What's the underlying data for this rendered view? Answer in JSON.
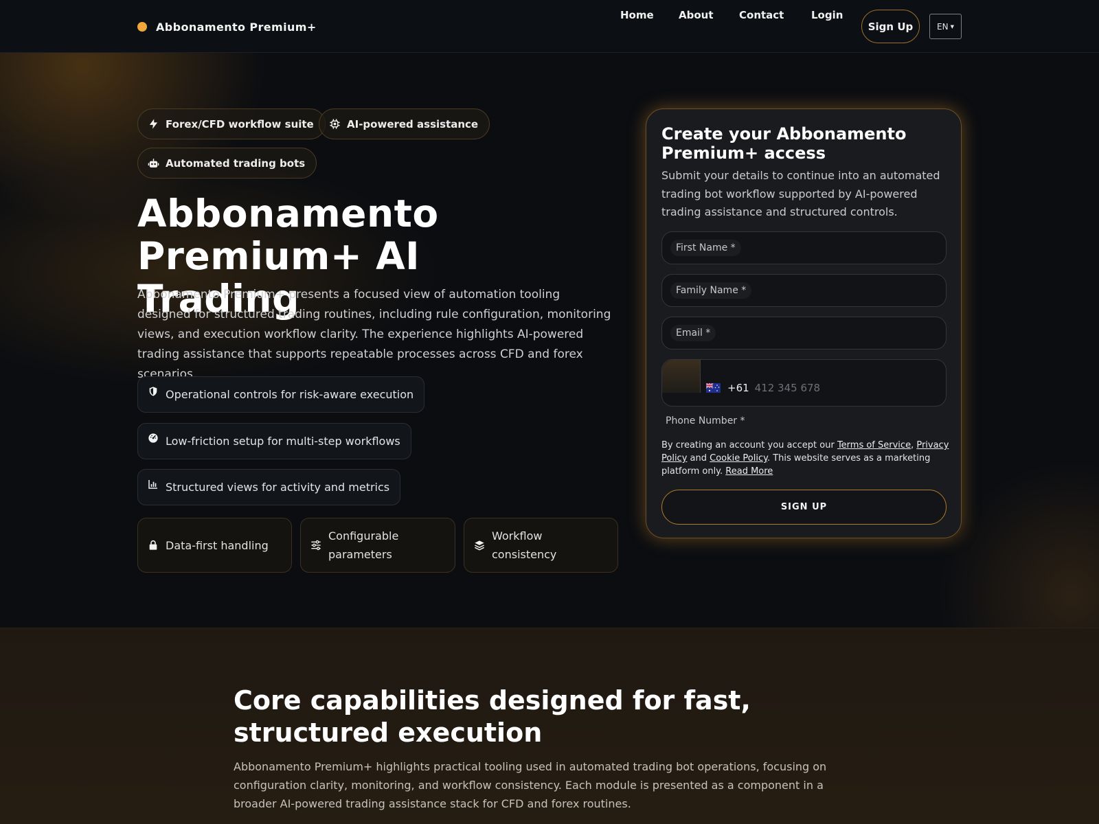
{
  "header": {
    "brand": "Abbonamento Premium+",
    "nav": [
      "Home",
      "About",
      "Contact",
      "Login"
    ],
    "signup_label": "Sign Up",
    "language": "EN"
  },
  "hero": {
    "chips": [
      "Forex/CFD workflow suite",
      "AI-powered assistance",
      "Automated trading bots"
    ],
    "title": "Abbonamento Premium+ AI Trading",
    "description": "Abbonamento Premium+ presents a focused view of automation tooling designed for structured trading routines, including rule configuration, monitoring views, and execution workflow clarity. The experience highlights AI-powered trading assistance that supports repeatable processes across CFD and forex scenarios.",
    "features": [
      "Operational controls for risk-aware execution",
      "Low-friction setup for multi-step workflows",
      "Structured views for activity and metrics"
    ],
    "cards": [
      "Data-first handling",
      "Configurable parameters",
      "Workflow consistency"
    ]
  },
  "form": {
    "title": "Create your Abbonamento Premium+ access",
    "subtitle": "Submit your details to continue into an automated trading bot workflow supported by AI-powered trading assistance and structured controls.",
    "first_name_label": "First Name *",
    "family_name_label": "Family Name *",
    "email_label": "Email *",
    "dial_code": "+61",
    "phone_placeholder": "412 345 678",
    "phone_label": "Phone Number *",
    "legal": {
      "prefix": "By creating an account you accept our ",
      "terms": "Terms of Service",
      "sep1": ", ",
      "privacy": "Privacy Policy",
      "and": " and ",
      "cookie": "Cookie Policy",
      "suffix": ". This website serves as a marketing platform only. ",
      "read_more": "Read More"
    },
    "submit_label": "SIGN UP"
  },
  "capabilities": {
    "title": "Core capabilities designed for fast, structured execution",
    "description": "Abbonamento Premium+ highlights practical tooling used in automated trading bot operations, focusing on configuration clarity, monitoring, and workflow consistency. Each module is presented as a component in a broader AI-powered trading assistance stack for CFD and forex routines."
  },
  "colors": {
    "accent": "#f0a63a",
    "background": "#0b0d11"
  }
}
